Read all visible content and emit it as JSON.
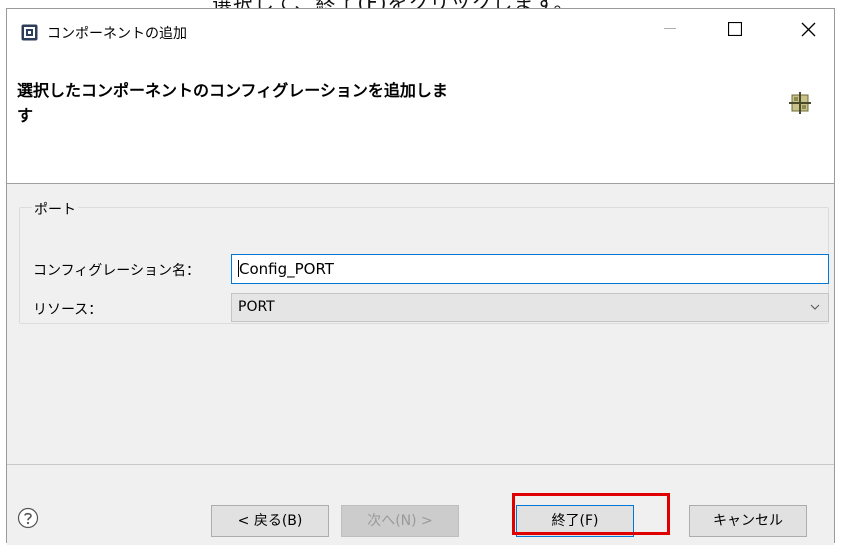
{
  "top_caption": "選択して、終了(F)をクリックします。",
  "window": {
    "title": "コンポーネントの追加",
    "controls": {
      "minimize": "minimize-icon",
      "maximize": "maximize-icon",
      "close": "close-icon"
    }
  },
  "header": {
    "title": "選択したコンポーネントのコンフィグレーションを追加します",
    "icon": "component-grid-icon"
  },
  "group": {
    "label": "ポート",
    "config_name_label": "コンフィグレーション名：",
    "config_name_value": "Config_PORT",
    "resource_label": "リソース：",
    "resource_value": "PORT"
  },
  "footer": {
    "help_icon": "question-mark-icon",
    "back_label": "< 戻る(B)",
    "next_label": "次へ(N) >",
    "finish_label": "終了(F)",
    "cancel_label": "キャンセル"
  },
  "colors": {
    "highlight": "#e00000",
    "focus_border": "#0078d7",
    "dialog_bg": "#f0f0f0"
  }
}
